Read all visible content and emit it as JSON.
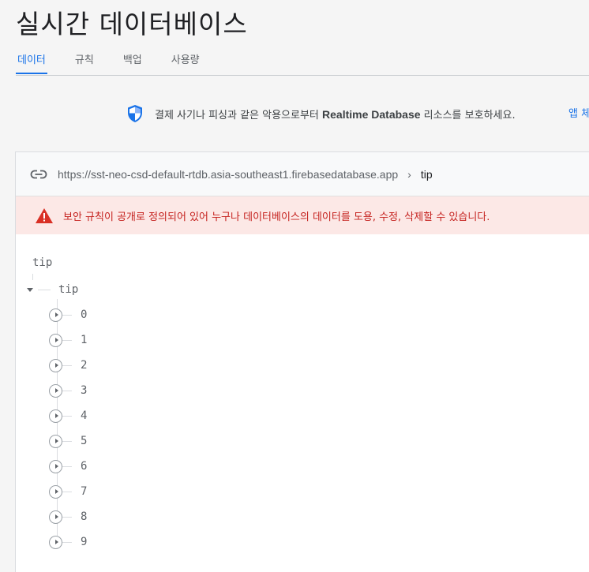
{
  "page": {
    "title": "실시간 데이터베이스"
  },
  "tabs": [
    {
      "label": "데이터",
      "active": true
    },
    {
      "label": "규칙",
      "active": false
    },
    {
      "label": "백업",
      "active": false
    },
    {
      "label": "사용량",
      "active": false
    }
  ],
  "banner": {
    "icon": "shield-icon",
    "text_before": "결제 사기나 피싱과 같은 악용으로부터 ",
    "text_bold": "Realtime Database",
    "text_after": " 리소스를 보호하세요.",
    "link": "앱 체"
  },
  "urlbar": {
    "icon": "link-icon",
    "url": "https://sst-neo-csd-default-rtdb.asia-southeast1.firebasedatabase.app",
    "separator": "›",
    "crumb": "tip"
  },
  "warning": {
    "icon": "warning-icon",
    "text": "보안 규칙이 공개로 정의되어 있어 누구나 데이터베이스의 데이터를 도용, 수정, 삭제할 수 있습니다."
  },
  "tree": {
    "root_label": "tip",
    "node": {
      "key": "tip",
      "expanded": true,
      "children": [
        "0",
        "1",
        "2",
        "3",
        "4",
        "5",
        "6",
        "7",
        "8",
        "9"
      ]
    }
  },
  "colors": {
    "accent": "#1a73e8",
    "warning_bg": "#fce8e6",
    "warning_text": "#c5221f",
    "shield": "#1a73e8",
    "warning_icon": "#d93025"
  }
}
